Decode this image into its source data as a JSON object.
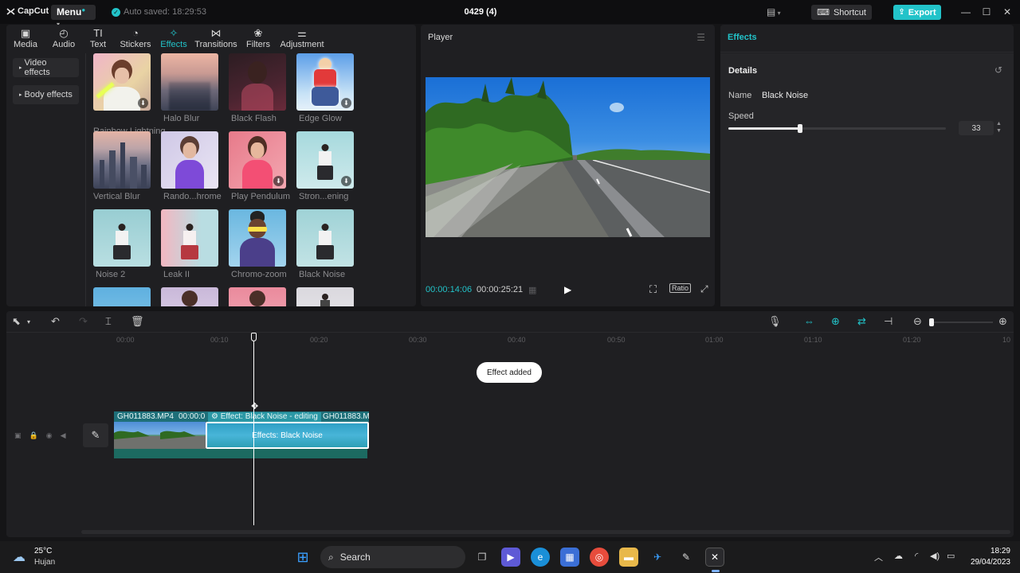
{
  "titlebar": {
    "logo": "CapCut",
    "menu_label": "Menu",
    "autosave": "Auto saved: 18:29:53",
    "project_title": "0429 (4)",
    "shortcut_label": "Shortcut",
    "export_label": "Export"
  },
  "tabs": [
    {
      "label": "Media",
      "icon": "media-icon"
    },
    {
      "label": "Audio",
      "icon": "audio-icon"
    },
    {
      "label": "Text",
      "icon": "text-icon"
    },
    {
      "label": "Stickers",
      "icon": "stickers-icon"
    },
    {
      "label": "Effects",
      "icon": "effects-icon",
      "active": true
    },
    {
      "label": "Transitions",
      "icon": "transitions-icon"
    },
    {
      "label": "Filters",
      "icon": "filters-icon"
    },
    {
      "label": "Adjustment",
      "icon": "adjustment-icon"
    }
  ],
  "sidebar": {
    "items": [
      {
        "label": "Video effects"
      },
      {
        "label": "Body effects"
      }
    ]
  },
  "effects": [
    {
      "label": "Rainbow Lightning",
      "download": true
    },
    {
      "label": "Halo Blur",
      "download": false
    },
    {
      "label": "Black Flash",
      "download": false
    },
    {
      "label": "Edge Glow",
      "download": true
    },
    {
      "label": "Vertical Blur",
      "download": false
    },
    {
      "label": "Rando...hrome",
      "download": false
    },
    {
      "label": "Play Pendulum",
      "download": true
    },
    {
      "label": "Stron...ening",
      "download": true
    },
    {
      "label": "Noise 2",
      "download": false
    },
    {
      "label": "Leak II",
      "download": false
    },
    {
      "label": "Chromo-zoom",
      "download": false
    },
    {
      "label": "Black Noise",
      "download": false
    }
  ],
  "player": {
    "header": "Player",
    "current_time": "00:00:14:06",
    "total_time": "00:00:25:21",
    "ratio_label": "Ratio"
  },
  "details": {
    "panel_title": "Effects",
    "section_title": "Details",
    "name_label": "Name",
    "name_value": "Black Noise",
    "speed_label": "Speed",
    "speed_value": "33",
    "speed_fraction": 0.33
  },
  "timeline": {
    "ruler": [
      "00:00",
      "00:10",
      "00:20",
      "00:30",
      "00:40",
      "00:50",
      "01:00",
      "01:10",
      "01:20",
      "10"
    ],
    "toast": "Effect added",
    "clip1_label": "GH011883.MP4",
    "clip1_time": "00:00:0",
    "effect_label": "Effect: Black Noise - editing",
    "clip2_label": "GH011883.M",
    "effect_clip_text": "Effects: Black Noise"
  },
  "taskbar": {
    "weather_temp": "25°C",
    "weather_desc": "Hujan",
    "search_label": "Search",
    "time": "18:29",
    "date": "29/04/2023"
  },
  "colors": {
    "accent": "#22c3c9",
    "panel": "#1f1f22",
    "background": "#151517"
  }
}
